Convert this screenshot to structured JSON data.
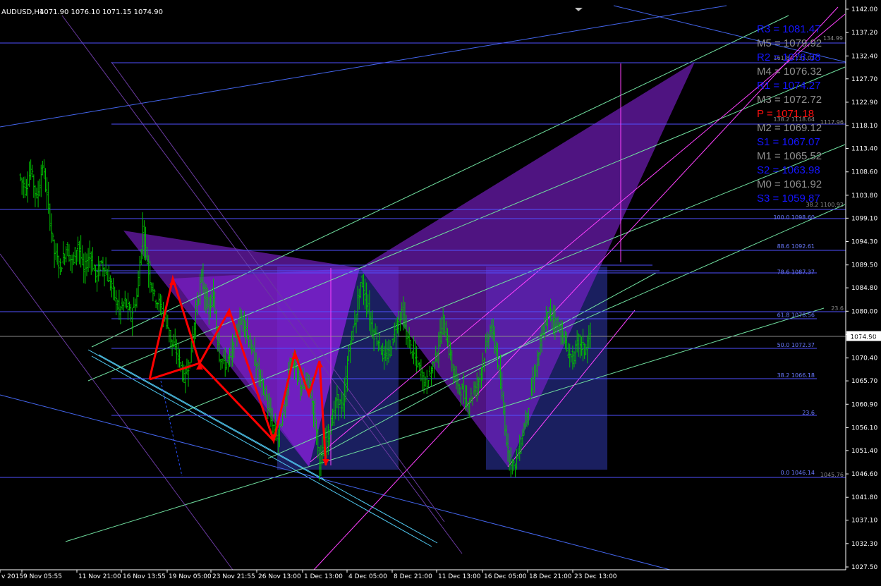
{
  "header": {
    "title": "AUDUSD,H4",
    "ohlc": "1071.90 1076.10 1071.15 1074.90"
  },
  "current_price": "1074.90",
  "price_axis": [
    "1142.00",
    "1137.20",
    "1132.40",
    "1127.70",
    "1122.90",
    "1118.10",
    "1113.40",
    "1108.60",
    "1103.80",
    "1099.10",
    "1094.30",
    "1089.50",
    "1084.80",
    "1080.00",
    "1075.20",
    "1070.40",
    "1065.70",
    "1060.90",
    "1056.10",
    "1051.40",
    "1046.60",
    "1041.80",
    "1037.10",
    "1032.30",
    "1027.50"
  ],
  "time_axis": [
    "v 2015",
    "9 Nov 05:55",
    "11 Nov 21:00",
    "16 Nov 13:55",
    "19 Nov 05:00",
    "23 Nov 21:55",
    "26 Nov 13:00",
    "1 Dec 13:00",
    "4 Dec 05:00",
    "8 Dec 21:00",
    "11 Dec 13:00",
    "16 Dec 05:00",
    "18 Dec 21:00",
    "23 Dec 13:00"
  ],
  "pivots": [
    {
      "label": "R3 = 1081.47",
      "color": "#1515ff"
    },
    {
      "label": "M5 = 1079.92",
      "color": "#909090"
    },
    {
      "label": "R2 = 1078.38",
      "color": "#1515ff"
    },
    {
      "label": "M4 = 1076.32",
      "color": "#909090"
    },
    {
      "label": "R1 = 1074.27",
      "color": "#1515ff"
    },
    {
      "label": "M3 = 1072.72",
      "color": "#909090"
    },
    {
      "label": "P  = 1071.18",
      "color": "#ff1010"
    },
    {
      "label": "M2 = 1069.12",
      "color": "#909090"
    },
    {
      "label": "S1 = 1067.07",
      "color": "#1515ff"
    },
    {
      "label": "M1 = 1065.52",
      "color": "#909090"
    },
    {
      "label": "S2 = 1063.98",
      "color": "#1515ff"
    },
    {
      "label": "M0 = 1061.92",
      "color": "#909090"
    },
    {
      "label": "S3 = 1059.87",
      "color": "#1515ff"
    }
  ],
  "fib_labels": [
    {
      "text": "100.0 1098.60",
      "price": 1098.6
    },
    {
      "text": "88.6 1092.61",
      "price": 1092.61
    },
    {
      "text": "78.6 1087.37",
      "price": 1087.37
    },
    {
      "text": "61.8 1078.56",
      "price": 1078.56
    },
    {
      "text": "50.0 1072.37",
      "price": 1072.37
    },
    {
      "text": "38.2 1066.18",
      "price": 1066.18
    },
    {
      "text": "23.6",
      "price": 1058.5
    },
    {
      "text": "0.0 1046.14",
      "price": 1046.14
    }
  ],
  "misc_labels": {
    "top_ext": "134.99",
    "ext_1618": "161.8 1131.02",
    "ext_1382": "138.2 1118.64",
    "ext_1382_b": "1117.96",
    "ext_382": "38.2 1100.92",
    "ext_236": "23.6",
    "low_ext": "1045.76"
  },
  "colors": {
    "background": "#000000",
    "candle": "#00c000",
    "axis_text": "#ffffff",
    "fib_line": "#5050ff",
    "channel_cyan": "#40c0e0",
    "channel_green": "#70e0a0",
    "pattern_fill": "#8020d0",
    "pattern_red": "#ff0000",
    "magenta": "#ff40ff"
  },
  "chart_data": {
    "type": "candlestick",
    "symbol": "AUDUSD",
    "timeframe": "H4",
    "ylim": [
      1027.5,
      1142.0
    ],
    "current_price": 1074.9,
    "last_bar": {
      "open": 1071.9,
      "high": 1076.1,
      "low": 1071.15,
      "close": 1074.9
    },
    "price_path": [
      [
        0,
        1108
      ],
      [
        1,
        1105
      ],
      [
        2,
        1109
      ],
      [
        3,
        1103
      ],
      [
        4,
        1110
      ],
      [
        5,
        1101
      ],
      [
        6,
        1092
      ],
      [
        7,
        1089
      ],
      [
        8,
        1093
      ],
      [
        9,
        1090
      ],
      [
        10,
        1094
      ],
      [
        11,
        1088
      ],
      [
        12,
        1092
      ],
      [
        13,
        1087
      ],
      [
        14,
        1090
      ],
      [
        15,
        1087
      ],
      [
        16,
        1084
      ],
      [
        17,
        1080
      ],
      [
        18,
        1082
      ],
      [
        19,
        1079
      ],
      [
        20,
        1083
      ],
      [
        21,
        1097
      ],
      [
        22,
        1088
      ],
      [
        23,
        1083
      ],
      [
        24,
        1081
      ],
      [
        25,
        1078
      ],
      [
        26,
        1073
      ],
      [
        27,
        1071
      ],
      [
        28,
        1066
      ],
      [
        29,
        1070
      ],
      [
        30,
        1080
      ],
      [
        31,
        1087
      ],
      [
        32,
        1080
      ],
      [
        33,
        1083
      ],
      [
        34,
        1071
      ],
      [
        35,
        1069
      ],
      [
        36,
        1071
      ],
      [
        37,
        1076
      ],
      [
        38,
        1079
      ],
      [
        39,
        1074
      ],
      [
        40,
        1070
      ],
      [
        41,
        1066
      ],
      [
        42,
        1062
      ],
      [
        43,
        1056
      ],
      [
        44,
        1054
      ],
      [
        45,
        1060
      ],
      [
        46,
        1070
      ],
      [
        47,
        1068
      ],
      [
        48,
        1064
      ],
      [
        49,
        1066
      ],
      [
        50,
        1060
      ],
      [
        51,
        1049
      ],
      [
        52,
        1053
      ],
      [
        53,
        1057
      ],
      [
        54,
        1062
      ],
      [
        55,
        1060
      ],
      [
        56,
        1072
      ],
      [
        57,
        1078
      ],
      [
        58,
        1086
      ],
      [
        59,
        1082
      ],
      [
        60,
        1076
      ],
      [
        61,
        1074
      ],
      [
        62,
        1070
      ],
      [
        63,
        1072
      ],
      [
        64,
        1077
      ],
      [
        65,
        1080
      ],
      [
        66,
        1074
      ],
      [
        67,
        1071
      ],
      [
        68,
        1068
      ],
      [
        69,
        1065
      ],
      [
        70,
        1068
      ],
      [
        71,
        1072
      ],
      [
        72,
        1078
      ],
      [
        73,
        1072
      ],
      [
        74,
        1066
      ],
      [
        75,
        1064
      ],
      [
        76,
        1061
      ],
      [
        77,
        1063
      ],
      [
        78,
        1066
      ],
      [
        79,
        1071
      ],
      [
        80,
        1077
      ],
      [
        81,
        1072
      ],
      [
        82,
        1062
      ],
      [
        83,
        1051
      ],
      [
        84,
        1048
      ],
      [
        85,
        1052
      ],
      [
        86,
        1058
      ],
      [
        87,
        1064
      ],
      [
        88,
        1070
      ],
      [
        89,
        1076
      ],
      [
        90,
        1080
      ],
      [
        91,
        1078
      ],
      [
        92,
        1076
      ],
      [
        93,
        1072
      ],
      [
        94,
        1070
      ],
      [
        95,
        1074
      ],
      [
        96,
        1072
      ],
      [
        97,
        1075
      ]
    ],
    "pattern_points": [
      [
        1,
        1058
      ],
      [
        2,
        1087
      ],
      [
        3,
        1070
      ],
      [
        4,
        1080
      ],
      [
        5,
        1054
      ],
      [
        6,
        1071
      ],
      [
        7,
        1065
      ],
      [
        8,
        1070
      ],
      [
        9,
        1049
      ]
    ],
    "fibonacci": [
      {
        "level": 100.0,
        "price": 1098.6
      },
      {
        "level": 88.6,
        "price": 1092.61
      },
      {
        "level": 78.6,
        "price": 1087.37
      },
      {
        "level": 61.8,
        "price": 1078.56
      },
      {
        "level": 50.0,
        "price": 1072.37
      },
      {
        "level": 38.2,
        "price": 1066.18
      },
      {
        "level": 23.6
      },
      {
        "level": 0.0,
        "price": 1046.14
      }
    ],
    "pivots": {
      "R3": 1081.47,
      "M5": 1079.92,
      "R2": 1078.38,
      "M4": 1076.32,
      "R1": 1074.27,
      "M3": 1072.72,
      "P": 1071.18,
      "M2": 1069.12,
      "S1": 1067.07,
      "M1": 1065.52,
      "S2": 1063.98,
      "M0": 1061.92,
      "S3": 1059.87
    }
  }
}
